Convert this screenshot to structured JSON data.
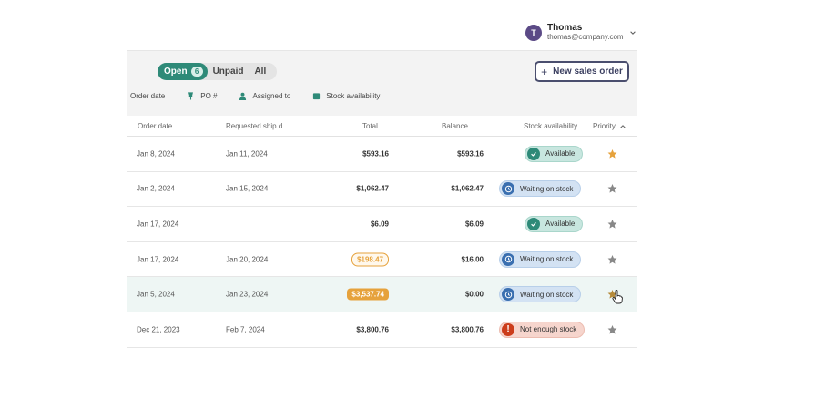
{
  "user": {
    "initial": "T",
    "name": "Thomas",
    "email": "thomas@company.com"
  },
  "tabs": [
    {
      "label": "Open",
      "count": "6",
      "active": true
    },
    {
      "label": "Unpaid",
      "active": false
    },
    {
      "label": "All",
      "active": false
    }
  ],
  "new_order_label": "New sales order",
  "filters": [
    "Order date",
    "PO #",
    "Assigned to",
    "Stock availability"
  ],
  "columns": [
    "Order date",
    "Requested ship d...",
    "Total",
    "Balance",
    "Stock availability",
    "Priority"
  ],
  "rows": [
    {
      "order_date": "Jan 8, 2024",
      "ship_date": "Jan 11, 2024",
      "total": "$593.16",
      "balance": "$593.16",
      "stock": "Available"
    },
    {
      "order_date": "Jan 2, 2024",
      "ship_date": "Jan 15, 2024",
      "total": "$1,062.47",
      "balance": "$1,062.47",
      "stock": "Waiting on stock"
    },
    {
      "order_date": "Jan 17, 2024",
      "ship_date": "",
      "total": "$6.09",
      "balance": "$6.09",
      "stock": "Available"
    },
    {
      "order_date": "Jan 17, 2024",
      "ship_date": "Jan 20, 2024",
      "total": "$198.47",
      "balance": "$16.00",
      "stock": "Waiting on stock"
    },
    {
      "order_date": "Jan 5, 2024",
      "ship_date": "Jan 23, 2024",
      "total": "$3,537.74",
      "balance": "$0.00",
      "stock": "Waiting on stock"
    },
    {
      "order_date": "Dec 21, 2023",
      "ship_date": "Feb 7, 2024",
      "total": "$3,800.76",
      "balance": "$3,800.76",
      "stock": "Not enough stock"
    }
  ],
  "colors": {
    "accent": "#2e8a78",
    "button_border": "#4a4e6e",
    "star_active": "#e6a23c",
    "star_inactive": "#888888"
  }
}
